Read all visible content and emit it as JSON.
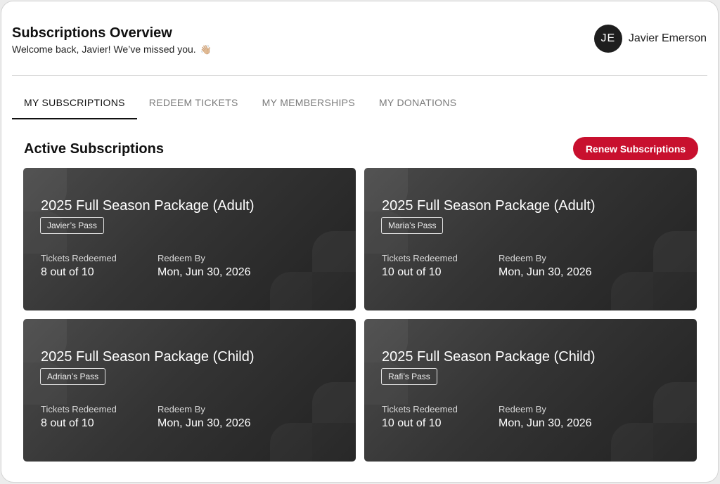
{
  "header": {
    "title": "Subscriptions Overview",
    "welcome": "Welcome back, Javier! We’ve missed you.",
    "welcome_emoji": "👋🏼",
    "user": {
      "initials": "JE",
      "name": "Javier Emerson"
    }
  },
  "tabs": [
    {
      "label": "MY SUBSCRIPTIONS",
      "active": true
    },
    {
      "label": "REDEEM TICKETS",
      "active": false
    },
    {
      "label": "MY MEMBERSHIPS",
      "active": false
    },
    {
      "label": "MY DONATIONS",
      "active": false
    }
  ],
  "section": {
    "title": "Active Subscriptions",
    "renew_label": "Renew Subscriptions"
  },
  "colors": {
    "accent": "#c8102e",
    "card_dark": "#2b2b2b"
  },
  "cards": [
    {
      "title": "2025 Full Season Package (Adult)",
      "pass": "Javier’s Pass",
      "redeemed_label": "Tickets Redeemed",
      "redeemed_value": "8 out of 10",
      "redeem_by_label": "Redeem By",
      "redeem_by_value": "Mon, Jun 30, 2026"
    },
    {
      "title": "2025 Full Season Package (Adult)",
      "pass": "Maria’s Pass",
      "redeemed_label": "Tickets Redeemed",
      "redeemed_value": "10 out of 10",
      "redeem_by_label": "Redeem By",
      "redeem_by_value": "Mon, Jun 30, 2026"
    },
    {
      "title": "2025 Full Season Package (Child)",
      "pass": "Adrian’s Pass",
      "redeemed_label": "Tickets Redeemed",
      "redeemed_value": "8 out of 10",
      "redeem_by_label": "Redeem By",
      "redeem_by_value": "Mon, Jun 30, 2026"
    },
    {
      "title": "2025 Full Season Package (Child)",
      "pass": "Rafi’s Pass",
      "redeemed_label": "Tickets Redeemed",
      "redeemed_value": "10 out of 10",
      "redeem_by_label": "Redeem By",
      "redeem_by_value": "Mon, Jun 30, 2026"
    }
  ]
}
